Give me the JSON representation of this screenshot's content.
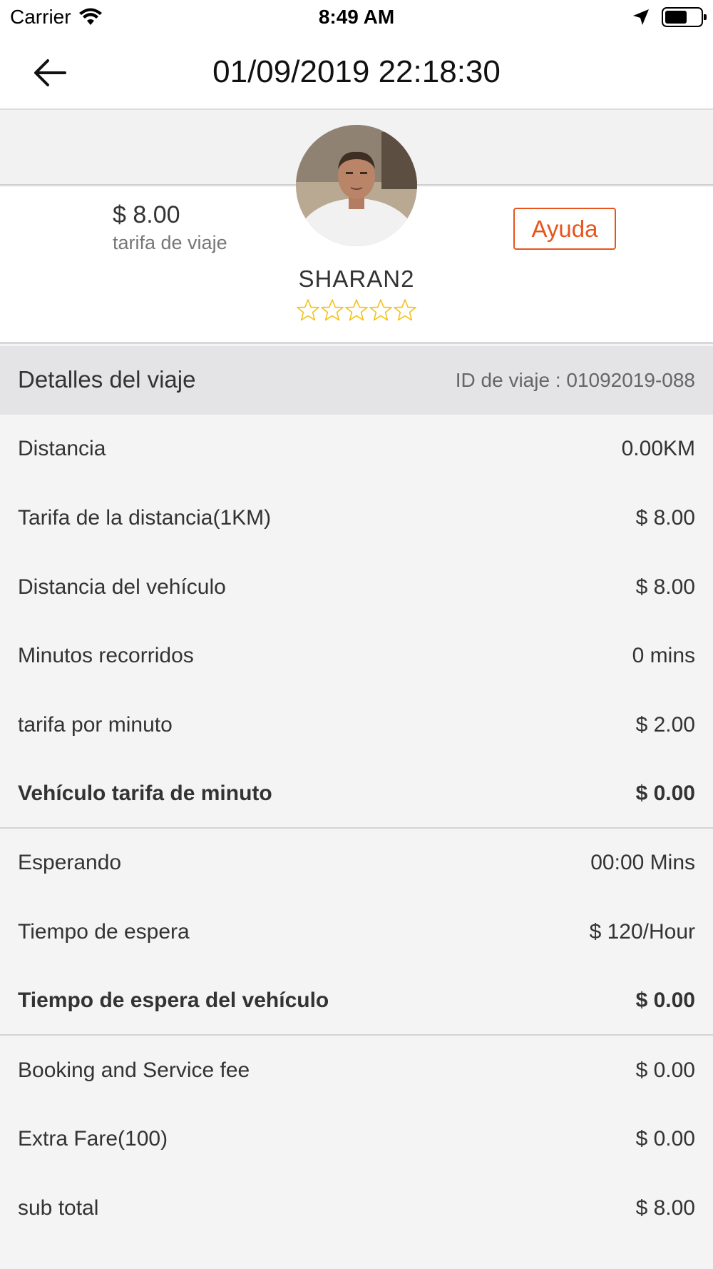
{
  "status_bar": {
    "carrier": "Carrier",
    "time": "8:49 AM"
  },
  "nav": {
    "title": "01/09/2019 22:18:30"
  },
  "summary": {
    "fare_amount": "$ 8.00",
    "fare_label": "tarifa de viaje",
    "help_label": "Ayuda",
    "driver_name": "SHARAN2",
    "rating_stars": 0,
    "rating_max": 5
  },
  "details": {
    "title": "Detalles del viaje",
    "trip_id": "ID de viaje : 01092019-088",
    "rows": [
      {
        "label": "Distancia",
        "value": "0.00KM"
      },
      {
        "label": "Tarifa de la distancia(1KM)",
        "value": "$ 8.00"
      },
      {
        "label": "Distancia del vehículo",
        "value": "$ 8.00"
      },
      {
        "label": "Minutos recorridos",
        "value": "0 mins"
      },
      {
        "label": "tarifa por minuto",
        "value": "$ 2.00"
      },
      {
        "label": "Vehículo tarifa de minuto",
        "value": "$ 0.00"
      },
      {
        "label": "Esperando",
        "value": "00:00 Mins"
      },
      {
        "label": "Tiempo de espera",
        "value": "$ 120/Hour"
      },
      {
        "label": "Tiempo de espera del vehículo",
        "value": "$ 0.00"
      },
      {
        "label": "Booking and Service fee",
        "value": "$ 0.00"
      },
      {
        "label": "Extra Fare(100)",
        "value": "$ 0.00"
      },
      {
        "label": "sub total",
        "value": "$ 8.00"
      }
    ]
  },
  "colors": {
    "accent": "#e8541d",
    "star": "#f2c21b"
  },
  "icons": [
    "wifi-icon",
    "location-arrow-icon",
    "battery-icon",
    "back-arrow-icon",
    "star-icon"
  ]
}
